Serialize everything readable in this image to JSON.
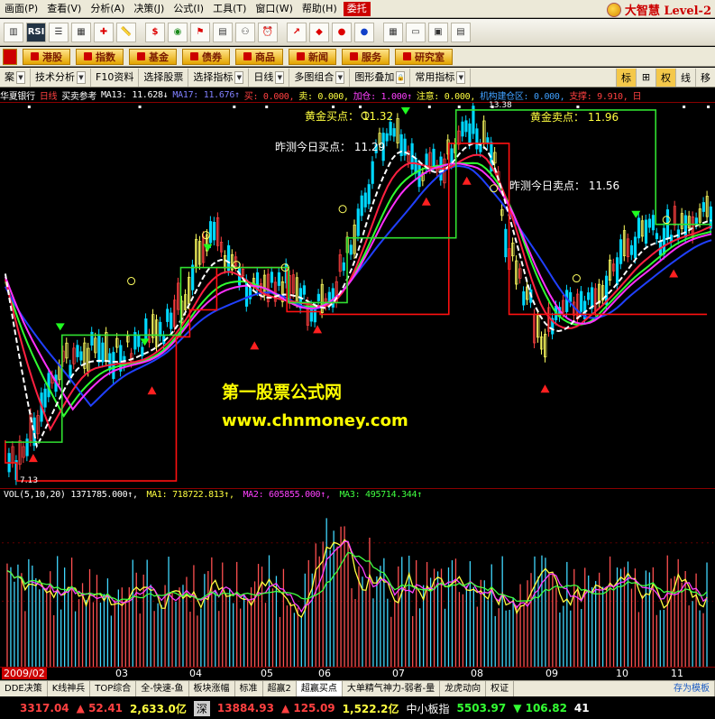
{
  "menu": [
    "画面(P)",
    "查看(V)",
    "分析(A)",
    "决策(J)",
    "公式(I)",
    "工具(T)",
    "窗口(W)",
    "帮助(H)"
  ],
  "menu_trade": "委托",
  "brand": "大智慧 Level-2",
  "toolbar_icons": [
    "chart-icon",
    "rsi-icon",
    "list-icon",
    "grid-icon",
    "crosshair-icon",
    "ruler-icon",
    "dollar-icon",
    "strategy-icon",
    "filter-icon",
    "scan-icon",
    "binoculars-icon",
    "alarm-icon",
    "stock-icon",
    "diamond-icon",
    "fund-icon",
    "link-icon",
    "grid2-icon",
    "window-icon",
    "layout-icon",
    "calendar-icon"
  ],
  "toolbar_labels": {
    "rsi": "RSI",
    "dollar": "$"
  },
  "categories": [
    "港股",
    "指数",
    "基金",
    "债券",
    "商品",
    "新闻",
    "服务",
    "研究室"
  ],
  "subbar": {
    "items": [
      "案",
      "技术分析",
      "F10资料",
      "选择股票",
      "选择指标",
      "日线",
      "多图组合",
      "图形叠加",
      "常用指标"
    ],
    "right": [
      "标",
      "⊞",
      "权",
      "线",
      "移"
    ]
  },
  "infoline": {
    "name": "华夏银行",
    "period": "日线",
    "indicator": "买卖参考",
    "ma13": "MA13: 11.628↓",
    "ma17": "MA17: 11.676↑",
    "buy": "买: 0.000,",
    "sell": "卖: 0.000,",
    "add": "加仓: 1.000↑",
    "note": "注意: 0.000,",
    "inst": "机构建仓区: 0.000,",
    "support": "支撑: 9.910,",
    "tail": "日"
  },
  "annotations": {
    "gold_buy": "黄金买点： 11.32",
    "gold_sell": "黄金卖点： 11.96",
    "pred_buy": "昨测今日买点： 11.29",
    "pred_sell": "昨测今日卖点： 11.56",
    "low_marker": "7.13",
    "high_marker": "13.38"
  },
  "watermark": {
    "title": "第一股票公式网",
    "url": "www.chnmoney.com"
  },
  "volume_info": {
    "vol": "VOL(5,10,20) 1371785.000↑,",
    "ma1": "MA1: 718722.813↑,",
    "ma2": "MA2: 605855.000↑,",
    "ma3": "MA3: 495714.344↑"
  },
  "dates": [
    "2009/02",
    "03",
    "04",
    "05",
    "06",
    "07",
    "08",
    "09",
    "10",
    "11"
  ],
  "tabs": [
    "DDE决策",
    "K线神兵",
    "TOP综合",
    "全-快速-鱼",
    "板块涨幅",
    "标准",
    "超赢2",
    "超赢买点",
    "大单精气神力-弱者-量",
    "龙虎动向",
    "权证",
    "存为模板"
  ],
  "status": {
    "sh_index": "3317.04",
    "sh_change": "▲ 52.41",
    "sh_amount": "2,633.0亿",
    "sz_label": "深",
    "sz_index": "13884.93",
    "sz_change": "▲ 125.09",
    "sz_amount": "1,522.2亿",
    "board_label": "中小板指",
    "board_index": "5503.97",
    "board_change": "▼ 106.82",
    "tail": "41"
  },
  "colors": {
    "up": "#ff3030",
    "down": "#00ffff",
    "ma_white": "#ffffff",
    "ma_blue": "#2040ff",
    "ma_magenta": "#ff30ff",
    "ma_red": "#ff2040",
    "ma_green": "#30ff30",
    "step_green": "#30e030",
    "step_red": "#ff1010",
    "vol_ma_yellow": "#ffff40",
    "vol_ma_magenta": "#ff40ff",
    "vol_ma_green": "#40ff40"
  }
}
